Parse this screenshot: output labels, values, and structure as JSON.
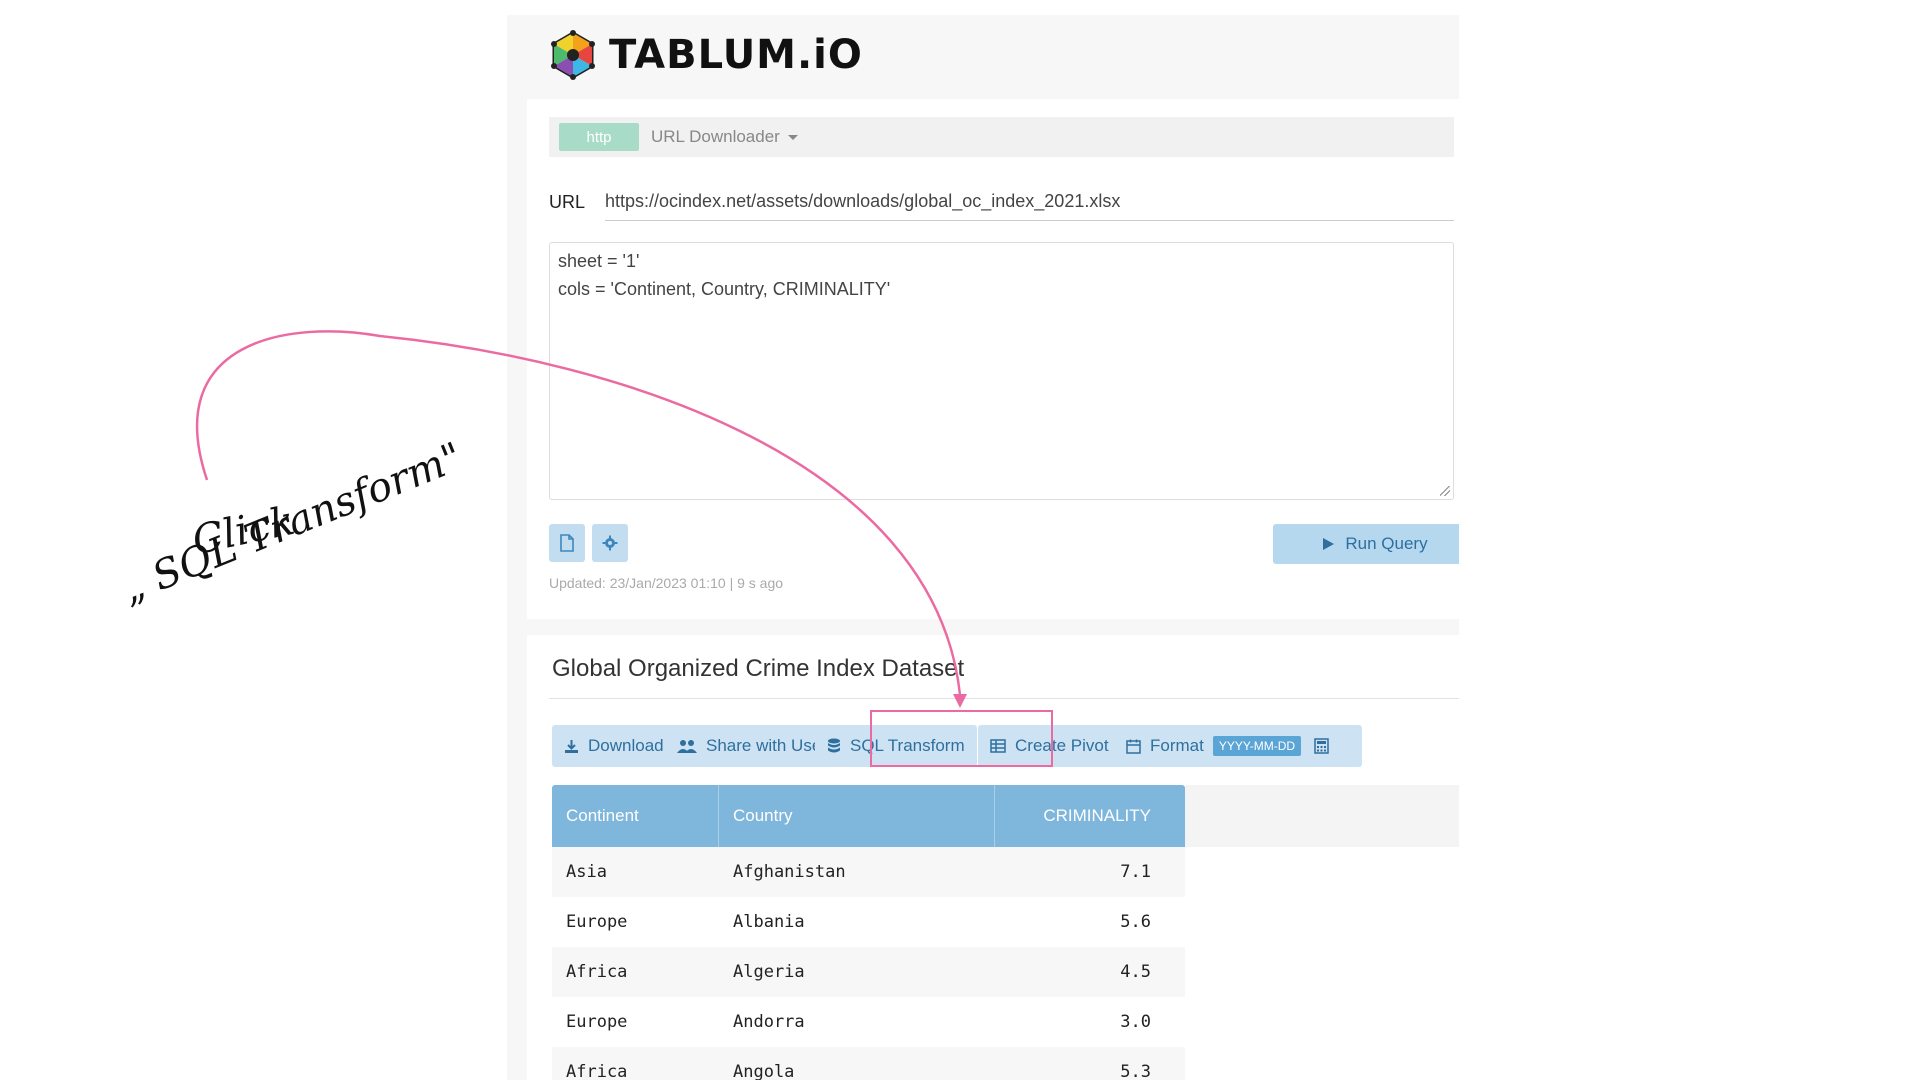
{
  "app": {
    "logo_text": "TABLUM.iO"
  },
  "connection": {
    "badge": "http",
    "name": "URL Downloader"
  },
  "url_field": {
    "label": "URL",
    "value": "https://ocindex.net/assets/downloads/global_oc_index_2021.xlsx"
  },
  "query": {
    "line1": "sheet = '1'",
    "line2": "cols = 'Continent, Country, CRIMINALITY'"
  },
  "icons": {
    "file": "file-icon",
    "settings": "gear-icon",
    "run": "play-icon"
  },
  "run_button": {
    "label": "Run Query"
  },
  "updated_text": "Updated: 23/Jan/2023 01:10 | 9 s ago",
  "dataset": {
    "title": "Global Organized Crime Index Dataset",
    "toolbar": {
      "download": "Download",
      "share": "Share with User",
      "sql_transform": "SQL Transform",
      "create_pivot": "Create Pivot",
      "format": "Format",
      "format_badge": "YYYY-MM-DD"
    },
    "columns": [
      "Continent",
      "Country",
      "CRIMINALITY"
    ],
    "rows": [
      [
        "Asia",
        "Afghanistan",
        "7.1"
      ],
      [
        "Europe",
        "Albania",
        "5.6"
      ],
      [
        "Africa",
        "Algeria",
        "4.5"
      ],
      [
        "Europe",
        "Andorra",
        "3.0"
      ],
      [
        "Africa",
        "Angola",
        "5.3"
      ]
    ]
  },
  "annotation": {
    "line1": "Click",
    "line2": "„ SQL Transform\"",
    "accent_color": "#ec6aa2"
  },
  "colors": {
    "button_bg": "#cde3f3",
    "button_text": "#2f6f9e",
    "header_bg": "#7fb6dc",
    "http_badge": "#a8dcc8"
  }
}
